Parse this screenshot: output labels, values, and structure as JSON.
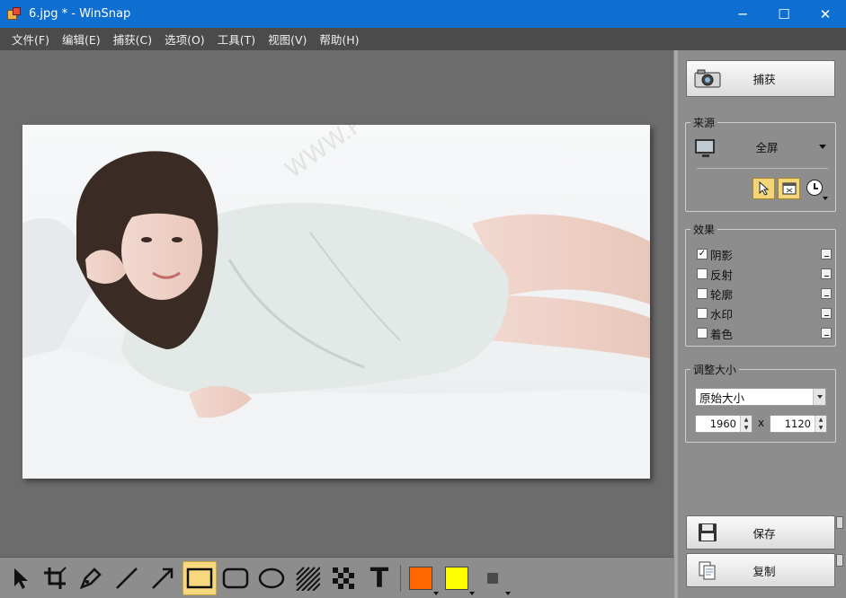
{
  "window": {
    "title": "6.jpg * - WinSnap",
    "minimize": "─",
    "maximize": "☐",
    "close": "✕"
  },
  "menu": [
    "文件(F)",
    "编辑(E)",
    "捕获(C)",
    "选项(O)",
    "工具(T)",
    "视图(V)",
    "帮助(H)"
  ],
  "sidebar": {
    "capture_label": "捕获",
    "source": {
      "title": "来源",
      "value": "全屏"
    },
    "effects": {
      "title": "效果",
      "items": [
        {
          "label": "阴影",
          "checked": true
        },
        {
          "label": "反射",
          "checked": false
        },
        {
          "label": "轮廓",
          "checked": false
        },
        {
          "label": "水印",
          "checked": false
        },
        {
          "label": "着色",
          "checked": false
        }
      ]
    },
    "resize": {
      "title": "调整大小",
      "mode": "原始大小",
      "width": "1960",
      "x": "x",
      "height": "1120"
    },
    "save_label": "保存",
    "copy_label": "复制"
  },
  "toolbar": {
    "tools": [
      "pointer-icon",
      "crop-icon",
      "pen-icon",
      "line-icon",
      "arrow-icon",
      "rectangle-icon",
      "rounded-rect-icon",
      "ellipse-icon",
      "hatch-icon",
      "pixelate-icon",
      "text-icon"
    ],
    "active_tool": "rectangle-icon",
    "text_tool_glyph": "T",
    "colors": {
      "primary": "#ff6600",
      "secondary": "#ffff00",
      "small": "#4a4a4a"
    }
  },
  "colors": {
    "titlebar": "#0f6fd0",
    "menubar": "#4b4b4b",
    "canvas": "#6c6c6c",
    "sidebar": "#8d8d8d",
    "highlight": "#f7d87e"
  }
}
